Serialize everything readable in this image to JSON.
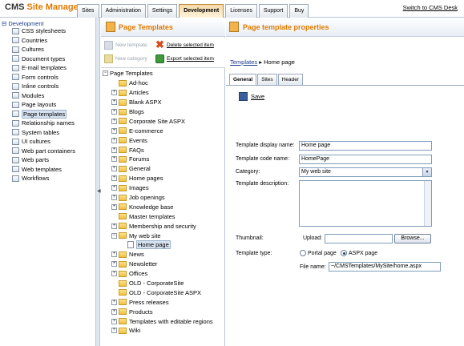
{
  "app": {
    "logo_cms": "CMS",
    "logo_rest": "Site Manager",
    "switch_link": "Switch to CMS Desk"
  },
  "tabs": [
    "Sites",
    "Administration",
    "Settings",
    "Development",
    "Licenses",
    "Support",
    "Buy"
  ],
  "active_tab": "Development",
  "leftnav": {
    "root": "Development",
    "items": [
      "CSS stylesheets",
      "Countries",
      "Cultures",
      "Document types",
      "E-mail templates",
      "Form controls",
      "Inline controls",
      "Modules",
      "Page layouts",
      "Page templates",
      "Relationship names",
      "System tables",
      "UI cultures",
      "Web part containers",
      "Web parts",
      "Web templates",
      "Workflows"
    ],
    "selected": "Page templates"
  },
  "middle": {
    "title": "Page Templates",
    "actions": {
      "new_template": "New template",
      "delete_selected": "Delete selected item",
      "new_category": "New category",
      "export_selected": "Export selected item"
    },
    "tree_root": "Page Templates",
    "tree": [
      {
        "label": "Ad-hoc",
        "expander": "",
        "level": 1
      },
      {
        "label": "Articles",
        "expander": "+",
        "level": 1
      },
      {
        "label": "Blank ASPX",
        "expander": "+",
        "level": 1
      },
      {
        "label": "Blogs",
        "expander": "+",
        "level": 1
      },
      {
        "label": "Corporate Site ASPX",
        "expander": "+",
        "level": 1
      },
      {
        "label": "E-commerce",
        "expander": "+",
        "level": 1
      },
      {
        "label": "Events",
        "expander": "+",
        "level": 1
      },
      {
        "label": "FAQs",
        "expander": "+",
        "level": 1
      },
      {
        "label": "Forums",
        "expander": "+",
        "level": 1
      },
      {
        "label": "General",
        "expander": "+",
        "level": 1
      },
      {
        "label": "Home pages",
        "expander": "+",
        "level": 1
      },
      {
        "label": "Images",
        "expander": "+",
        "level": 1
      },
      {
        "label": "Job openings",
        "expander": "+",
        "level": 1
      },
      {
        "label": "Knowledge base",
        "expander": "+",
        "level": 1
      },
      {
        "label": "Master templates",
        "expander": "",
        "level": 1
      },
      {
        "label": "Membership and security",
        "expander": "+",
        "level": 1
      },
      {
        "label": "My web site",
        "expander": "-",
        "level": 1
      },
      {
        "label": "Home page",
        "expander": "",
        "level": 2,
        "page": true,
        "selected": true
      },
      {
        "label": "News",
        "expander": "+",
        "level": 1
      },
      {
        "label": "Newsletter",
        "expander": "+",
        "level": 1
      },
      {
        "label": "Offices",
        "expander": "+",
        "level": 1
      },
      {
        "label": "OLD - CorporateSite",
        "expander": "",
        "level": 1
      },
      {
        "label": "OLD - CorporateSite ASPX",
        "expander": "",
        "level": 1
      },
      {
        "label": "Press releases",
        "expander": "+",
        "level": 1
      },
      {
        "label": "Products",
        "expander": "+",
        "level": 1
      },
      {
        "label": "Templates with editable regions",
        "expander": "+",
        "level": 1
      },
      {
        "label": "Wiki",
        "expander": "+",
        "level": 1
      }
    ]
  },
  "right": {
    "title": "Page template properties",
    "breadcrumb_link": "Templates",
    "breadcrumb_sep": "▸",
    "breadcrumb_current": "Home page",
    "tabs": [
      "General",
      "Sites",
      "Header"
    ],
    "active_tab": "General",
    "save_label": "Save",
    "form": {
      "display_name_label": "Template display name:",
      "display_name_value": "Home page",
      "code_name_label": "Template code name:",
      "code_name_value": "HomePage",
      "category_label": "Category:",
      "category_value": "My web site",
      "description_label": "Template description:",
      "thumbnail_label": "Thumbnail:",
      "upload_label": "Upload:",
      "browse_label": "Browse...",
      "type_label": "Template type:",
      "type_portal": "Portal page",
      "type_aspx": "ASPX page",
      "type_selected": "ASPX page",
      "file_name_label": "File name:",
      "file_name_value": "~/CMSTemplates/MySite/home.aspx"
    }
  }
}
